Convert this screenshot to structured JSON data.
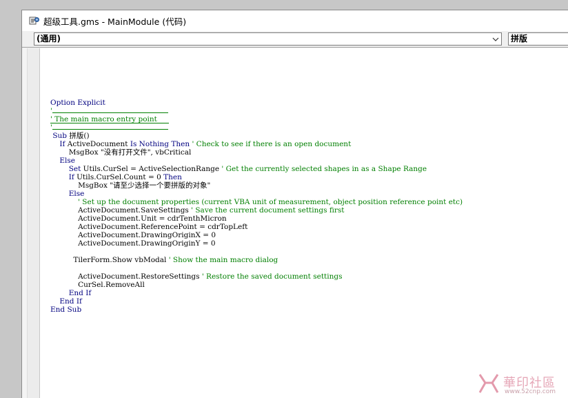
{
  "window": {
    "title": "超级工具.gms - MainModule (代码)"
  },
  "combos": {
    "object": "(通用)",
    "procedure": "拼版"
  },
  "code_lines": [
    {
      "indent": "",
      "parts": [
        {
          "t": "Option Explicit",
          "c": "kw"
        }
      ]
    },
    {
      "indent": "",
      "parts": [
        {
          "t": "'",
          "c": "cm"
        }
      ]
    },
    {
      "indent": "",
      "parts": [
        {
          "t": "' The main macro entry point",
          "c": "cm"
        }
      ]
    },
    {
      "indent": "",
      "parts": [
        {
          "t": "'",
          "c": "cm"
        }
      ]
    },
    {
      "indent": " ",
      "parts": [
        {
          "t": "Sub",
          "c": "kw"
        },
        {
          "t": " 拼版()",
          "c": ""
        }
      ]
    },
    {
      "indent": "    ",
      "parts": [
        {
          "t": "If",
          "c": "kw"
        },
        {
          "t": " ActiveDocument ",
          "c": ""
        },
        {
          "t": "Is Nothing Then",
          "c": "kw"
        },
        {
          "t": " ' Check to see if there is an open document",
          "c": "cm"
        }
      ]
    },
    {
      "indent": "        ",
      "parts": [
        {
          "t": "MsgBox \"没有打开文件\", vbCritical",
          "c": ""
        }
      ]
    },
    {
      "indent": "    ",
      "parts": [
        {
          "t": "Else",
          "c": "kw"
        }
      ]
    },
    {
      "indent": "        ",
      "parts": [
        {
          "t": "Set",
          "c": "kw"
        },
        {
          "t": " Utils.CurSel = ActiveSelectionRange ",
          "c": ""
        },
        {
          "t": "' Get the currently selected shapes in as a Shape Range",
          "c": "cm"
        }
      ]
    },
    {
      "indent": "        ",
      "parts": [
        {
          "t": "If",
          "c": "kw"
        },
        {
          "t": " Utils.CurSel.Count = 0 ",
          "c": ""
        },
        {
          "t": "Then",
          "c": "kw"
        }
      ]
    },
    {
      "indent": "            ",
      "parts": [
        {
          "t": "MsgBox \"请至少选择一个要拼版的对象\"",
          "c": ""
        }
      ]
    },
    {
      "indent": "        ",
      "parts": [
        {
          "t": "Else",
          "c": "kw"
        }
      ]
    },
    {
      "indent": "            ",
      "parts": [
        {
          "t": "' Set up the document properties (current VBA unit of measurement, object position reference point etc)",
          "c": "cm"
        }
      ]
    },
    {
      "indent": "            ",
      "parts": [
        {
          "t": "ActiveDocument.SaveSettings ",
          "c": ""
        },
        {
          "t": "' Save the current document settings first",
          "c": "cm"
        }
      ]
    },
    {
      "indent": "            ",
      "parts": [
        {
          "t": "ActiveDocument.Unit = cdrTenthMicron",
          "c": ""
        }
      ]
    },
    {
      "indent": "            ",
      "parts": [
        {
          "t": "ActiveDocument.ReferencePoint = cdrTopLeft",
          "c": ""
        }
      ]
    },
    {
      "indent": "            ",
      "parts": [
        {
          "t": "ActiveDocument.DrawingOriginX = 0",
          "c": ""
        }
      ]
    },
    {
      "indent": "            ",
      "parts": [
        {
          "t": "ActiveDocument.DrawingOriginY = 0",
          "c": ""
        }
      ]
    },
    {
      "indent": "",
      "parts": []
    },
    {
      "indent": "          ",
      "parts": [
        {
          "t": "TilerForm.Show vbModal ",
          "c": ""
        },
        {
          "t": "' Show the main macro dialog",
          "c": "cm"
        }
      ]
    },
    {
      "indent": "",
      "parts": []
    },
    {
      "indent": "            ",
      "parts": [
        {
          "t": "ActiveDocument.RestoreSettings ",
          "c": ""
        },
        {
          "t": "' Restore the saved document settings",
          "c": "cm"
        }
      ]
    },
    {
      "indent": "            ",
      "parts": [
        {
          "t": "CurSel.RemoveAll",
          "c": ""
        }
      ]
    },
    {
      "indent": "        ",
      "parts": [
        {
          "t": "End If",
          "c": "kw"
        }
      ]
    },
    {
      "indent": "    ",
      "parts": [
        {
          "t": "End If",
          "c": "kw"
        }
      ]
    },
    {
      "indent": "",
      "parts": [
        {
          "t": "End Sub",
          "c": "kw"
        }
      ]
    }
  ],
  "watermark": {
    "brand": "華印社區",
    "url": "www.52cnp.com"
  },
  "colors": {
    "keyword": "#00007f",
    "comment": "#007f00",
    "text": "#000000"
  }
}
